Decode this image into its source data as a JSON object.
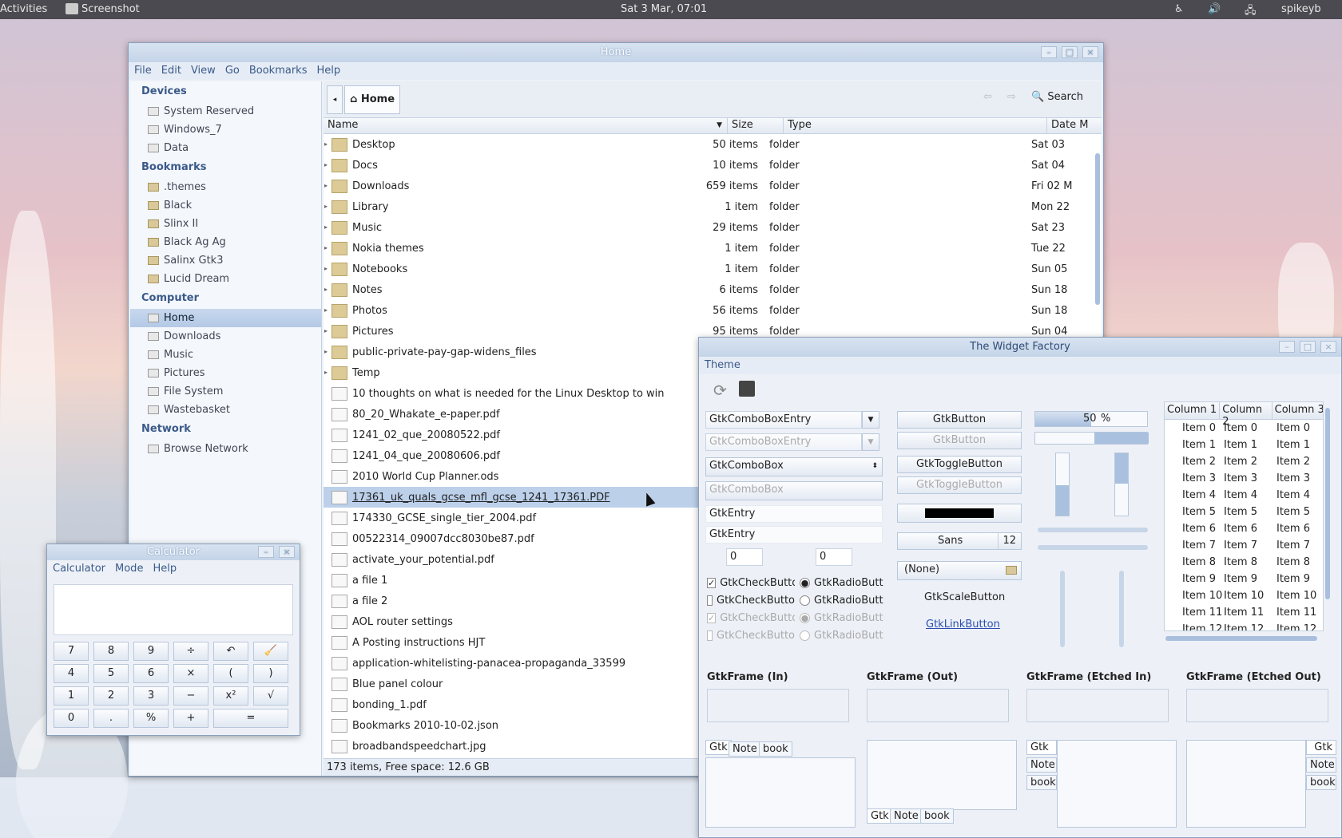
{
  "topbar": {
    "activities": "Activities",
    "app": "Screenshot",
    "clock": "Sat  3 Mar, 07:01",
    "user": "spikeyb"
  },
  "fm": {
    "title": "Home",
    "menu": [
      "File",
      "Edit",
      "View",
      "Go",
      "Bookmarks",
      "Help"
    ],
    "location": "Home",
    "search": "Search",
    "sidebar": {
      "devices_header": "Devices",
      "devices": [
        "System Reserved",
        "Windows_7",
        "Data"
      ],
      "bookmarks_header": "Bookmarks",
      "bookmarks": [
        ".themes",
        "Black",
        "Slinx II",
        "Black Ag Ag",
        "Salinx Gtk3",
        "Lucid Dream"
      ],
      "computer_header": "Computer",
      "computer": [
        "Home",
        "Downloads",
        "Music",
        "Pictures",
        "File System",
        "Wastebasket"
      ],
      "network_header": "Network",
      "network": [
        "Browse Network"
      ]
    },
    "columns": {
      "name": "Name",
      "size": "Size",
      "type": "Type",
      "date": "Date M"
    },
    "rows": [
      {
        "name": "Desktop",
        "size": "50 items",
        "type": "folder",
        "date": "Sat 03"
      },
      {
        "name": "Docs",
        "size": "10 items",
        "type": "folder",
        "date": "Sat 04"
      },
      {
        "name": "Downloads",
        "size": "659 items",
        "type": "folder",
        "date": "Fri 02 M"
      },
      {
        "name": "Library",
        "size": "1 item",
        "type": "folder",
        "date": "Mon 22"
      },
      {
        "name": "Music",
        "size": "29 items",
        "type": "folder",
        "date": "Sat 23"
      },
      {
        "name": "Nokia themes",
        "size": "1 item",
        "type": "folder",
        "date": "Tue 22"
      },
      {
        "name": "Notebooks",
        "size": "1 item",
        "type": "folder",
        "date": "Sun 05"
      },
      {
        "name": "Notes",
        "size": "6 items",
        "type": "folder",
        "date": "Sun 18"
      },
      {
        "name": "Photos",
        "size": "56 items",
        "type": "folder",
        "date": "Sun 18"
      },
      {
        "name": "Pictures",
        "size": "95 items",
        "type": "folder",
        "date": "Sun 04"
      },
      {
        "name": "public-private-pay-gap-widens_files",
        "size": "",
        "type": "",
        "date": ""
      },
      {
        "name": "Temp",
        "size": "",
        "type": "",
        "date": ""
      },
      {
        "name": "10 thoughts on what is needed for the Linux Desktop to win",
        "size": "",
        "type": "",
        "date": ""
      },
      {
        "name": "80_20_Whakate_e-paper.pdf",
        "size": "",
        "type": "",
        "date": ""
      },
      {
        "name": "1241_02_que_20080522.pdf",
        "size": "",
        "type": "",
        "date": ""
      },
      {
        "name": "1241_04_que_20080606.pdf",
        "size": "",
        "type": "",
        "date": ""
      },
      {
        "name": "2010 World Cup Planner.ods",
        "size": "",
        "type": "",
        "date": ""
      },
      {
        "name": "17361_uk_quals_gcse_mfl_gcse_1241_17361.PDF",
        "size": "",
        "type": "",
        "date": ""
      },
      {
        "name": "174330_GCSE_single_tier_2004.pdf",
        "size": "",
        "type": "",
        "date": ""
      },
      {
        "name": "00522314_09007dcc8030be87.pdf",
        "size": "",
        "type": "",
        "date": ""
      },
      {
        "name": "activate_your_potential.pdf",
        "size": "",
        "type": "",
        "date": ""
      },
      {
        "name": "a file 1",
        "size": "",
        "type": "",
        "date": ""
      },
      {
        "name": "a file 2",
        "size": "",
        "type": "",
        "date": ""
      },
      {
        "name": "AOL router settings",
        "size": "",
        "type": "",
        "date": ""
      },
      {
        "name": "A Posting instructions HJT",
        "size": "",
        "type": "",
        "date": ""
      },
      {
        "name": "application-whitelisting-panacea-propaganda_33599",
        "size": "",
        "type": "",
        "date": ""
      },
      {
        "name": "Blue panel colour",
        "size": "",
        "type": "",
        "date": ""
      },
      {
        "name": "bonding_1.pdf",
        "size": "",
        "type": "",
        "date": ""
      },
      {
        "name": "Bookmarks 2010-10-02.json",
        "size": "",
        "type": "",
        "date": ""
      },
      {
        "name": "broadbandspeedchart.jpg",
        "size": "",
        "type": "",
        "date": ""
      }
    ],
    "status": "173 items, Free space: 12.6 GB"
  },
  "calc": {
    "title": "Calculator",
    "menu": [
      "Calculator",
      "Mode",
      "Help"
    ],
    "keys": [
      [
        "7",
        "8",
        "9",
        "÷",
        "↶",
        "🧹"
      ],
      [
        "4",
        "5",
        "6",
        "×",
        "(",
        ")"
      ],
      [
        "1",
        "2",
        "3",
        "−",
        "x²",
        "√"
      ],
      [
        "0",
        ".",
        "%",
        "+",
        "="
      ]
    ]
  },
  "wf": {
    "title": "The Widget Factory",
    "menu": "Theme",
    "combo1": "GtkComboBoxEntry",
    "combo2": "GtkComboBoxEntry",
    "combo3": "GtkComboBox",
    "combo4": "GtkComboBox",
    "entry1": "GtkEntry",
    "entry2": "GtkEntry",
    "spin1": "0",
    "spin2": "0",
    "check": "GtkCheckButto",
    "radio": "GtkRadioButt",
    "button": "GtkButton",
    "toggle": "GtkToggleButton",
    "font": "Sans",
    "font_size": "12",
    "file": "(None)",
    "scale": "GtkScaleButton",
    "link": "GtkLinkButton",
    "progress": "50",
    "progress_unit": "%",
    "progress_fraction": 0.5,
    "list_headers": [
      "Column 1",
      "Column 2",
      "Column 3"
    ],
    "list_items": [
      "Item 0",
      "Item 1",
      "Item 2",
      "Item 3",
      "Item 4",
      "Item 5",
      "Item 6",
      "Item 7",
      "Item 8",
      "Item 9",
      "Item 10",
      "Item 11",
      "Item 12"
    ],
    "frames": [
      "GtkFrame (In)",
      "GtkFrame (Out)",
      "GtkFrame (Etched In)",
      "GtkFrame (Etched Out)"
    ],
    "tabs": [
      "Gtk",
      "Note",
      "book"
    ]
  }
}
